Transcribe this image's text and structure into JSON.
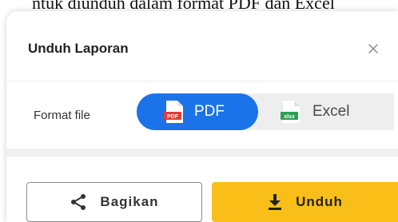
{
  "background_caption": "ntuk diunduh dalam format PDF dan Excel",
  "dialog": {
    "title": "Unduh Laporan",
    "close_icon": "close-icon"
  },
  "format": {
    "label": "Format file",
    "options": [
      {
        "label": "PDF",
        "icon": "pdf-file-icon",
        "icon_text": "PDF",
        "selected": true
      },
      {
        "label": "Excel",
        "icon": "xlsx-file-icon",
        "icon_text": "xlsx",
        "selected": false
      }
    ]
  },
  "actions": {
    "share_label": "Bagikan",
    "share_icon": "share-icon",
    "download_label": "Unduh",
    "download_icon": "download-icon"
  },
  "colors": {
    "selected_segment": "#1a73e8",
    "primary_button": "#f9bf18",
    "pdf_icon": "#e53935",
    "excel_icon": "#2e9e4f"
  }
}
